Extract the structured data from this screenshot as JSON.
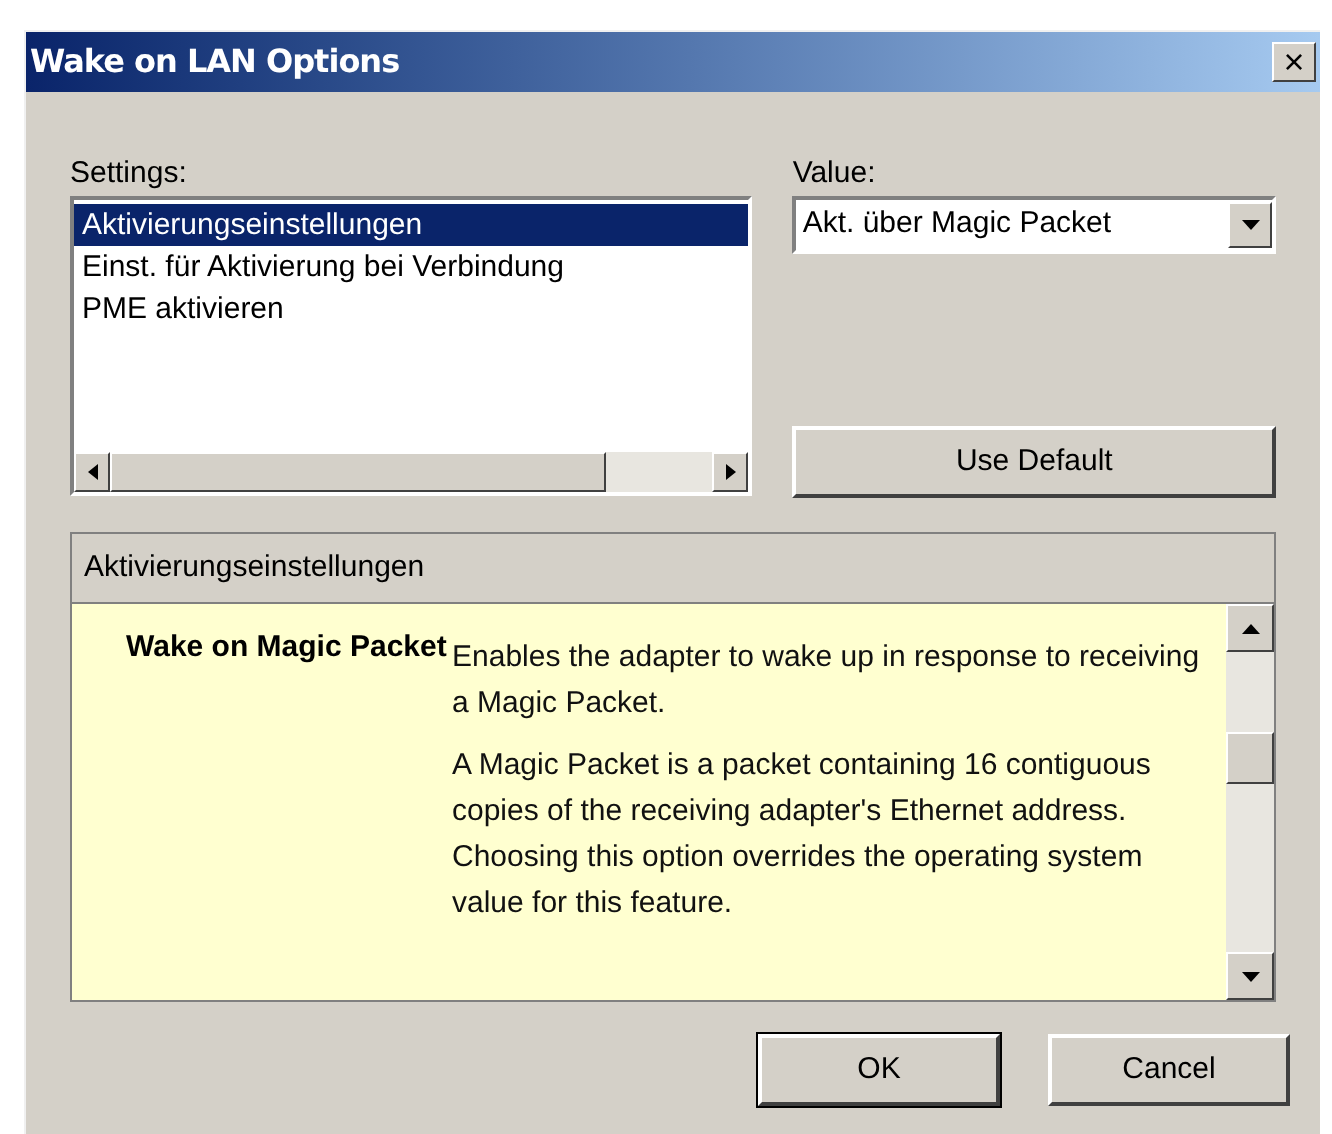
{
  "window": {
    "title": "Wake on LAN Options",
    "close": "×"
  },
  "settings": {
    "label": "Settings:",
    "items": [
      {
        "label": "Aktivierungseinstellungen",
        "selected": true
      },
      {
        "label": "Einst. für Aktivierung bei Verbindung",
        "selected": false
      },
      {
        "label": "PME aktivieren",
        "selected": false
      }
    ]
  },
  "value": {
    "label": "Value:",
    "selected": "Akt. über Magic Packet"
  },
  "use_default_button": "Use Default",
  "help": {
    "header": "Aktivierungseinstellungen",
    "term": "Wake on Magic Packet",
    "paragraphs": [
      "Enables the adapter to wake up in response to receiving a Magic Packet.",
      "A Magic Packet is a packet containing 16 contiguous copies of the receiving adapter's Ethernet address. Choosing this option overrides the operating system value for this feature."
    ]
  },
  "buttons": [
    {
      "label": "OK",
      "default": true
    },
    {
      "label": "Cancel",
      "default": false
    }
  ]
}
